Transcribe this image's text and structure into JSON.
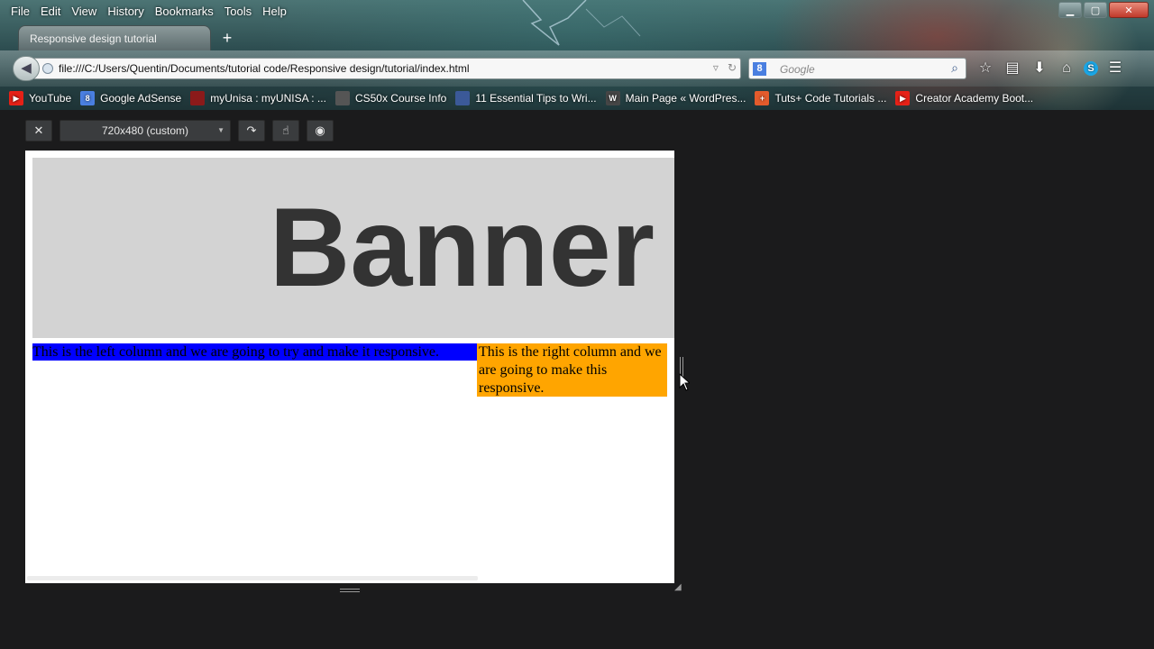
{
  "menubar": [
    "File",
    "Edit",
    "View",
    "History",
    "Bookmarks",
    "Tools",
    "Help"
  ],
  "tab": {
    "title": "Responsive design tutorial"
  },
  "new_tab_glyph": "+",
  "url": "file:///C:/Users/Quentin/Documents/tutorial code/Responsive design/tutorial/index.html",
  "search": {
    "badge": "8",
    "placeholder": "Google"
  },
  "bookmarks": [
    {
      "label": "YouTube",
      "icon": "youtube-icon",
      "color": "#e62117",
      "glyph": "▶"
    },
    {
      "label": "Google AdSense",
      "icon": "adsense-icon",
      "color": "#4a7fe0",
      "glyph": "8"
    },
    {
      "label": "myUnisa : myUNISA : ...",
      "icon": "unisa-icon",
      "color": "#8b1a1a",
      "glyph": ""
    },
    {
      "label": "CS50x Course Info",
      "icon": "cs50-icon",
      "color": "#555555",
      "glyph": ""
    },
    {
      "label": "11 Essential Tips to Wri...",
      "icon": "tips-icon",
      "color": "#3b5998",
      "glyph": ""
    },
    {
      "label": "Main Page « WordPres...",
      "icon": "wordpress-icon",
      "color": "#464646",
      "glyph": "W"
    },
    {
      "label": "Tuts+ Code Tutorials ...",
      "icon": "tuts-icon",
      "color": "#e35b2c",
      "glyph": "+"
    },
    {
      "label": "Creator Academy Boot...",
      "icon": "creator-academy-icon",
      "color": "#e62117",
      "glyph": "▶"
    }
  ],
  "responsive_toolbar": {
    "preset": "720x480 (custom)"
  },
  "page": {
    "banner": "Banner",
    "left_column": "This is the left column and we are going to try and make it responsive.",
    "right_column": "This is the right column and we are going to make this responsive."
  },
  "colors": {
    "banner_bg": "#d3d3d3",
    "banner_text": "#333333",
    "left_column_bg": "#0000ff",
    "right_column_bg": "#ffa500"
  }
}
